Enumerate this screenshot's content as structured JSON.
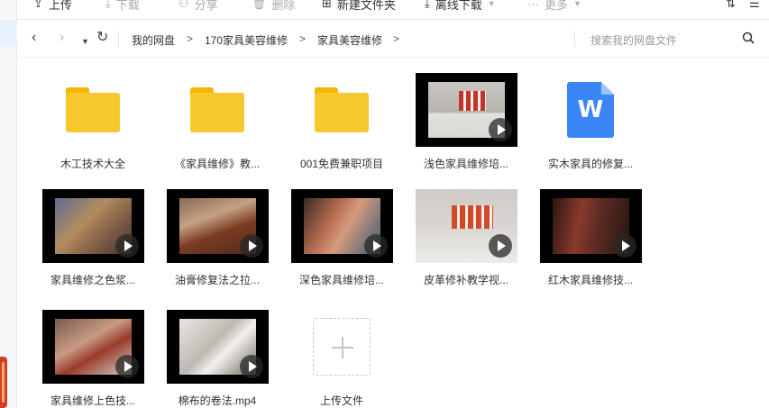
{
  "toolbar": {
    "upload": "上传",
    "download": "下载",
    "share": "分享",
    "delete": "删除",
    "new_folder": "新建文件夹",
    "offline_download": "离线下载",
    "more": "更多"
  },
  "nav": {
    "crumbs": [
      "我的网盘",
      "170家具美容维修",
      "家具美容维修"
    ],
    "search_placeholder": "搜索我的网盘文件"
  },
  "files": [
    {
      "name": "木工技术大全",
      "type": "folder"
    },
    {
      "name": "《家具维修》教...",
      "type": "folder"
    },
    {
      "name": "001免费兼职项目",
      "type": "folder"
    },
    {
      "name": "浅色家具维修培...",
      "type": "video"
    },
    {
      "name": "实木家具的修复...",
      "type": "word-doc"
    },
    {
      "name": "家具维修之色浆...",
      "type": "video"
    },
    {
      "name": "油膏修复法之拉...",
      "type": "video"
    },
    {
      "name": "深色家具维修培...",
      "type": "video"
    },
    {
      "name": "皮革修补教学视...",
      "type": "video"
    },
    {
      "name": "红木家具维修技...",
      "type": "video"
    },
    {
      "name": "家具维修上色技...",
      "type": "video"
    },
    {
      "name": "棉布的卷法.mp4",
      "type": "video"
    }
  ],
  "upload_tile": {
    "label": "上传文件"
  },
  "icons": {
    "doc_letter": "W"
  },
  "colors": {
    "folder": "#f7c72e",
    "word": "#3b86f6"
  }
}
